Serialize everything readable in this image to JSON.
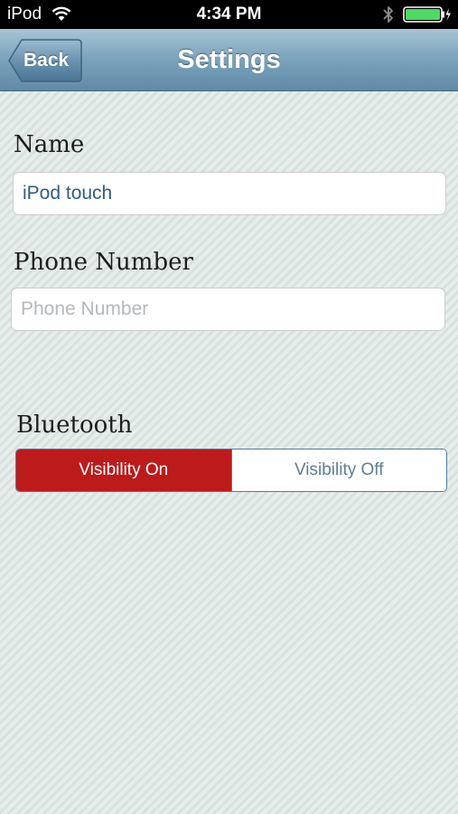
{
  "status_bar": {
    "carrier": "iPod",
    "time": "4:34 PM",
    "wifi_icon": "wifi-icon",
    "bluetooth_icon": "bluetooth-icon",
    "battery_icon": "battery-charging-icon",
    "battery_color": "#4cd964"
  },
  "nav_bar": {
    "back_label": "Back",
    "title": "Settings"
  },
  "form": {
    "name_label": "Name",
    "name_value": "iPod touch",
    "phone_label": "Phone Number",
    "phone_value": "",
    "phone_placeholder": "Phone Number",
    "bluetooth_label": "Bluetooth",
    "visibility_options": [
      "Visibility On",
      "Visibility Off"
    ],
    "visibility_selected": "Visibility On"
  },
  "colors": {
    "accent_red": "#bd1a1b",
    "segment_border": "#4a7fa6",
    "nav_gradient_top": "#a9c5d6",
    "nav_gradient_bottom": "#5f8aa6",
    "field_text": "#2f5c86"
  }
}
